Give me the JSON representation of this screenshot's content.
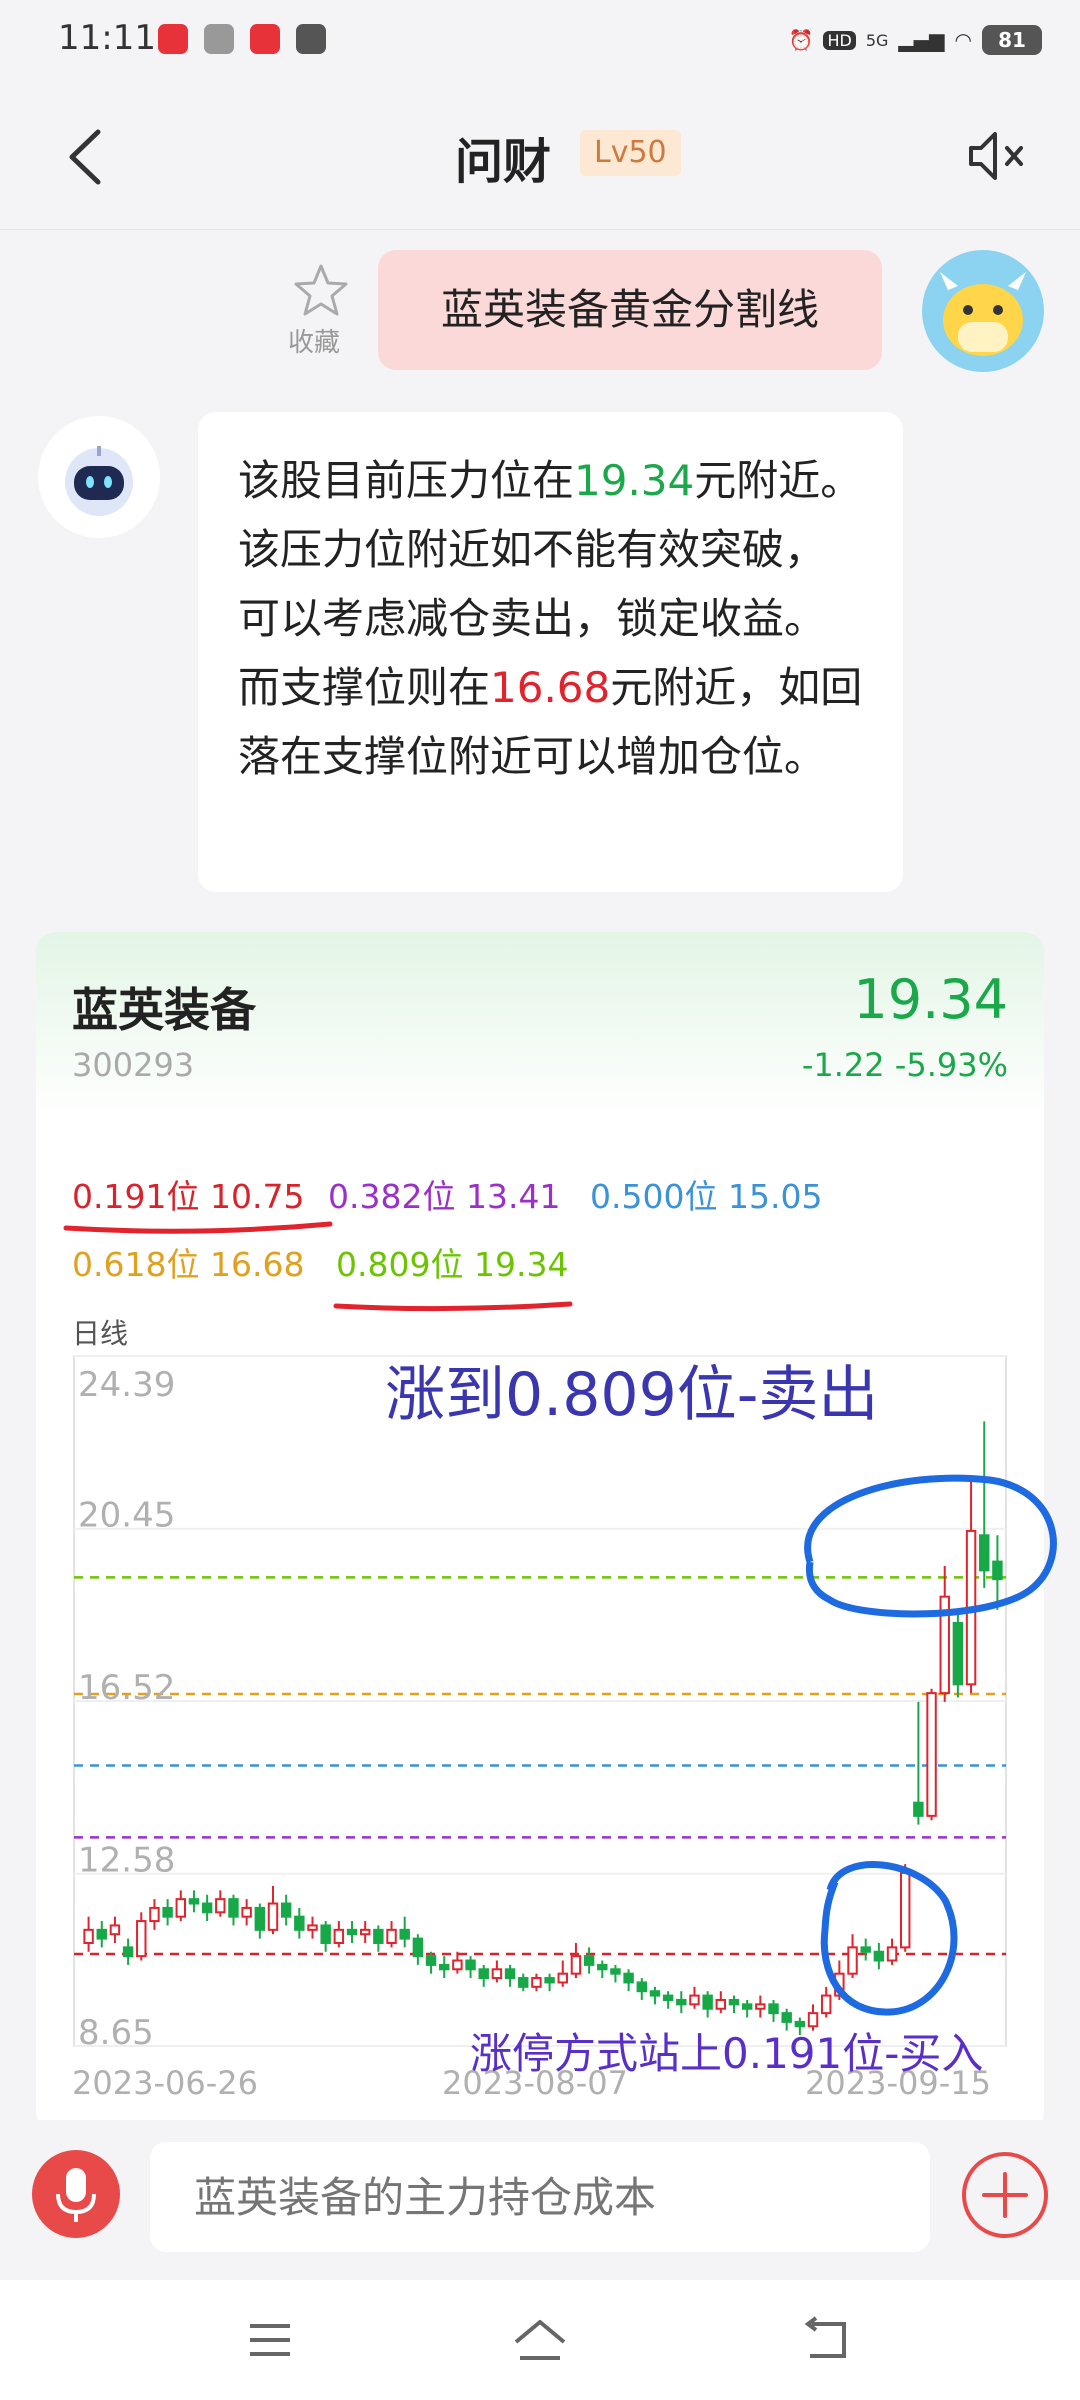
{
  "status_bar": {
    "time": "11:11",
    "signal_label": "5G",
    "battery": "81"
  },
  "header": {
    "title": "问财",
    "level": "Lv50"
  },
  "chat": {
    "favorite_label": "收藏",
    "user_query": "蓝英装备黄金分割线",
    "bot_reply": {
      "part1": "该股目前压力位在",
      "resistance": "19.34",
      "part2": "元附近。该压力位附近如不能有效突破，可以考虑减仓卖出，锁定收益。而支撑位则在",
      "support": "16.68",
      "part3": "元附近，如回落在支撑位附近可以增加仓位。"
    }
  },
  "stock": {
    "name": "蓝英装备",
    "code": "300293",
    "price": "19.34",
    "change": "-1.22",
    "change_pct": "-5.93%"
  },
  "fib_levels": [
    {
      "label": "0.191位",
      "value": "10.75",
      "color": "#d8232b"
    },
    {
      "label": "0.382位",
      "value": "13.41",
      "color": "#9b30c8"
    },
    {
      "label": "0.500位",
      "value": "15.05",
      "color": "#3a93d8"
    },
    {
      "label": "0.618位",
      "value": "16.68",
      "color": "#e0a020"
    },
    {
      "label": "0.809位",
      "value": "19.34",
      "color": "#6cc400"
    }
  ],
  "chart_label": "日线",
  "chart_data": {
    "type": "candlestick",
    "ylim": [
      8.65,
      24.39
    ],
    "y_ticks": [
      "24.39",
      "20.45",
      "16.52",
      "12.58",
      "8.65"
    ],
    "x_ticks": [
      "2023-06-26",
      "2023-08-07",
      "2023-09-15"
    ],
    "levels": [
      10.75,
      13.41,
      15.05,
      16.68,
      19.34
    ],
    "candles": [
      [
        11.0,
        11.3,
        10.8,
        11.6
      ],
      [
        11.3,
        11.1,
        10.9,
        11.5
      ],
      [
        11.2,
        11.4,
        11.0,
        11.6
      ],
      [
        10.9,
        10.7,
        10.5,
        11.1
      ],
      [
        10.7,
        11.5,
        10.6,
        11.7
      ],
      [
        11.5,
        11.8,
        11.3,
        12.0
      ],
      [
        11.8,
        11.6,
        11.4,
        12.0
      ],
      [
        11.6,
        12.0,
        11.5,
        12.2
      ],
      [
        12.0,
        11.9,
        11.7,
        12.2
      ],
      [
        11.9,
        11.7,
        11.5,
        12.1
      ],
      [
        11.7,
        12.0,
        11.6,
        12.2
      ],
      [
        12.0,
        11.6,
        11.4,
        12.1
      ],
      [
        11.6,
        11.8,
        11.4,
        12.0
      ],
      [
        11.8,
        11.3,
        11.1,
        11.9
      ],
      [
        11.3,
        11.9,
        11.2,
        12.3
      ],
      [
        11.9,
        11.6,
        11.4,
        12.1
      ],
      [
        11.6,
        11.3,
        11.1,
        11.8
      ],
      [
        11.3,
        11.4,
        11.1,
        11.6
      ],
      [
        11.4,
        11.0,
        10.8,
        11.5
      ],
      [
        11.0,
        11.3,
        10.9,
        11.5
      ],
      [
        11.3,
        11.2,
        11.0,
        11.5
      ],
      [
        11.2,
        11.3,
        11.0,
        11.5
      ],
      [
        11.3,
        11.0,
        10.8,
        11.4
      ],
      [
        11.0,
        11.3,
        10.9,
        11.5
      ],
      [
        11.3,
        11.1,
        10.9,
        11.6
      ],
      [
        11.1,
        10.7,
        10.5,
        11.2
      ],
      [
        10.7,
        10.5,
        10.3,
        10.8
      ],
      [
        10.5,
        10.4,
        10.2,
        10.7
      ],
      [
        10.4,
        10.6,
        10.3,
        10.8
      ],
      [
        10.6,
        10.4,
        10.2,
        10.7
      ],
      [
        10.4,
        10.2,
        10.0,
        10.5
      ],
      [
        10.2,
        10.4,
        10.1,
        10.6
      ],
      [
        10.4,
        10.2,
        10.0,
        10.5
      ],
      [
        10.2,
        10.0,
        9.9,
        10.3
      ],
      [
        10.0,
        10.2,
        9.9,
        10.3
      ],
      [
        10.2,
        10.1,
        9.9,
        10.3
      ],
      [
        10.1,
        10.3,
        10.0,
        10.6
      ],
      [
        10.3,
        10.7,
        10.2,
        11.0
      ],
      [
        10.7,
        10.5,
        10.3,
        10.9
      ],
      [
        10.5,
        10.4,
        10.2,
        10.6
      ],
      [
        10.4,
        10.3,
        10.1,
        10.5
      ],
      [
        10.3,
        10.1,
        9.9,
        10.4
      ],
      [
        10.1,
        9.9,
        9.7,
        10.2
      ],
      [
        9.9,
        9.8,
        9.6,
        10.0
      ],
      [
        9.8,
        9.7,
        9.5,
        9.9
      ],
      [
        9.7,
        9.6,
        9.4,
        9.9
      ],
      [
        9.6,
        9.8,
        9.5,
        10.0
      ],
      [
        9.8,
        9.5,
        9.3,
        9.9
      ],
      [
        9.5,
        9.7,
        9.4,
        9.9
      ],
      [
        9.7,
        9.6,
        9.4,
        9.8
      ],
      [
        9.6,
        9.5,
        9.3,
        9.7
      ],
      [
        9.5,
        9.6,
        9.3,
        9.8
      ],
      [
        9.6,
        9.4,
        9.2,
        9.7
      ],
      [
        9.4,
        9.2,
        9.0,
        9.5
      ],
      [
        9.2,
        9.1,
        8.9,
        9.3
      ],
      [
        9.1,
        9.4,
        9.0,
        9.6
      ],
      [
        9.4,
        9.8,
        9.3,
        10.0
      ],
      [
        9.8,
        10.3,
        9.7,
        10.6
      ],
      [
        10.3,
        10.9,
        10.2,
        11.2
      ],
      [
        10.9,
        10.8,
        10.6,
        11.1
      ],
      [
        10.8,
        10.6,
        10.4,
        11.0
      ],
      [
        10.6,
        10.9,
        10.5,
        11.1
      ],
      [
        10.9,
        12.6,
        10.8,
        12.8
      ],
      [
        14.2,
        13.9,
        13.7,
        16.5
      ],
      [
        13.9,
        16.7,
        13.8,
        16.8
      ],
      [
        16.7,
        18.9,
        16.5,
        19.6
      ],
      [
        18.3,
        16.9,
        16.6,
        18.5
      ],
      [
        16.9,
        20.4,
        16.7,
        21.6
      ],
      [
        20.3,
        19.5,
        19.1,
        22.9
      ],
      [
        19.7,
        19.3,
        18.6,
        20.3
      ]
    ]
  },
  "annotations": {
    "sell": "涨到0.809位-卖出",
    "buy": "涨停方式站上0.191位-买入"
  },
  "input": {
    "placeholder": "蓝英装备的主力持仓成本"
  }
}
